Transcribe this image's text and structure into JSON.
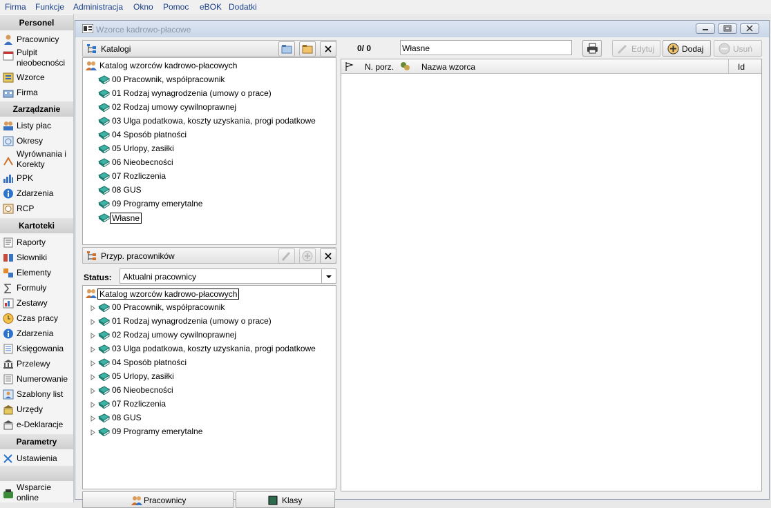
{
  "menu": [
    "Firma",
    "Funkcje",
    "Administracja",
    "Okno",
    "Pomoc",
    "eBOK",
    "Dodatki"
  ],
  "sidebar": {
    "sections": [
      "Personel",
      "Zarządzanie",
      "Kartoteki",
      "Parametry"
    ],
    "personel": [
      "Pracownicy",
      "Pulpit nieobecności",
      "Wzorce",
      "Firma"
    ],
    "zarzadzanie": [
      "Listy płac",
      "Okresy",
      "Wyrównania i Korekty",
      "PPK",
      "Zdarzenia",
      "RCP"
    ],
    "kartoteki": [
      "Raporty",
      "Słowniki",
      "Elementy",
      "Formuły",
      "Zestawy",
      "Czas pracy",
      "Zdarzenia",
      "Księgowania",
      "Przelewy",
      "Numerowanie",
      "Szablony list",
      "Urzędy",
      "e-Deklaracje"
    ],
    "parametry": [
      "Ustawienia"
    ],
    "footer": "Wsparcie online"
  },
  "window": {
    "title": "Wzorce kadrowo-płacowe"
  },
  "catalogs": {
    "title": "Katalogi",
    "root": "Katalog wzorców kadrowo-płacowych",
    "items": [
      "00 Pracownik, współpracownik",
      "01 Rodzaj wynagrodzenia (umowy o prace)",
      "02 Rodzaj umowy cywilnoprawnej",
      "03 Ulga podatkowa, koszty uzyskania, progi podatkowe",
      "04 Sposób płatności",
      "05 Urlopy, zasiłki",
      "06 Nieobecności",
      "07 Rozliczenia",
      "08 GUS",
      "09 Programy emerytalne",
      "Własne"
    ]
  },
  "assign": {
    "title": "Przyp. pracowników",
    "status_label": "Status:",
    "status_value": "Aktualni pracownicy",
    "root": "Katalog wzorców kadrowo-płacowych",
    "items": [
      "00 Pracownik, współpracownik",
      "01 Rodzaj wynagrodzenia (umowy o prace)",
      "02 Rodzaj umowy cywilnoprawnej",
      "03 Ulga podatkowa, koszty uzyskania, progi podatkowe",
      "04 Sposób płatności",
      "05 Urlopy, zasiłki",
      "06 Nieobecności",
      "07 Rozliczenia",
      "08 GUS",
      "09 Programy emerytalne"
    ]
  },
  "bottom_tabs": [
    "Pracownicy",
    "Klasy"
  ],
  "right": {
    "counter": "0/ 0",
    "catalog_field": "Własne",
    "edit_label": "Edytuj",
    "add_label": "Dodaj",
    "delete_label": "Usuń",
    "columns": [
      "N. porz.",
      "Nazwa wzorca",
      "Id"
    ]
  }
}
